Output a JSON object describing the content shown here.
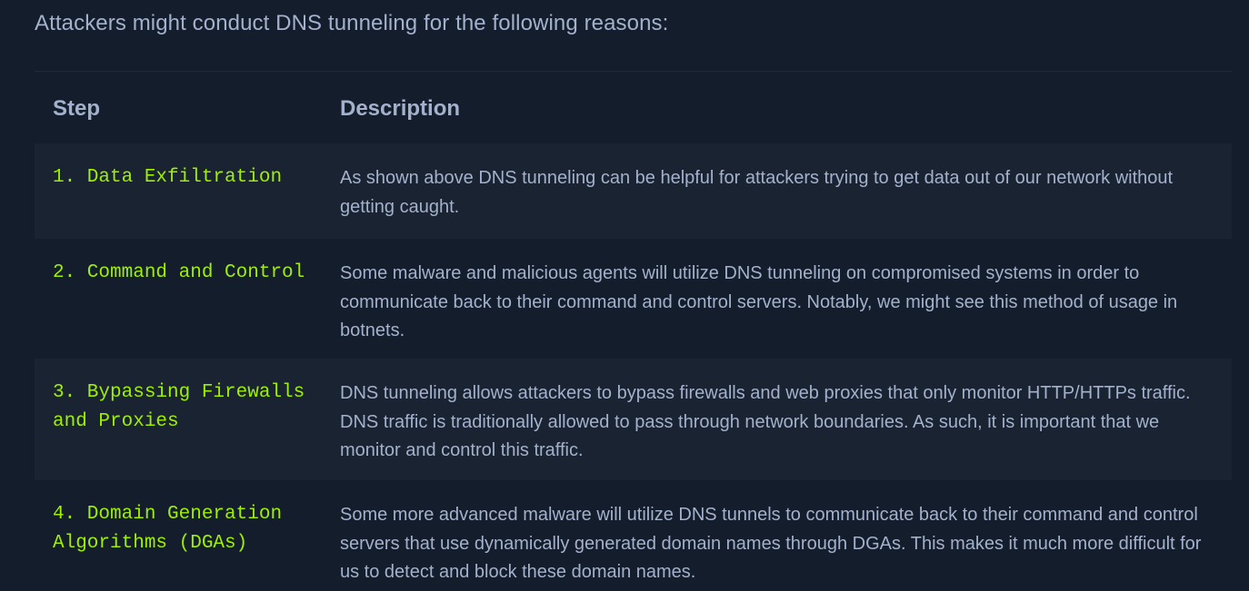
{
  "intro_text": "Attackers might conduct DNS tunneling for the following reasons:",
  "table": {
    "headers": {
      "step": "Step",
      "description": "Description"
    },
    "rows": [
      {
        "step": "1. Data Exfiltration",
        "description": "As shown above DNS tunneling can be helpful for attackers trying to get data out of our network without getting caught."
      },
      {
        "step": "2. Command and Control",
        "description": "Some malware and malicious agents will utilize DNS tunneling on compromised systems in order to communicate back to their command and control servers. Notably, we might see this method of usage in botnets."
      },
      {
        "step": "3. Bypassing Firewalls and Proxies",
        "description": "DNS tunneling allows attackers to bypass firewalls and web proxies that only monitor HTTP/HTTPs traffic. DNS traffic is traditionally allowed to pass through network boundaries. As such, it is important that we monitor and control this traffic."
      },
      {
        "step": "4. Domain Generation Algorithms (DGAs)",
        "description": "Some more advanced malware will utilize DNS tunnels to communicate back to their command and control servers that use dynamically generated domain names through DGAs. This makes it much more difficult for us to detect and block these domain names."
      }
    ]
  },
  "colors": {
    "background": "#141d2b",
    "row_alt": "#1a2332",
    "text": "#a4b1cd",
    "accent_green": "#9fef00"
  }
}
